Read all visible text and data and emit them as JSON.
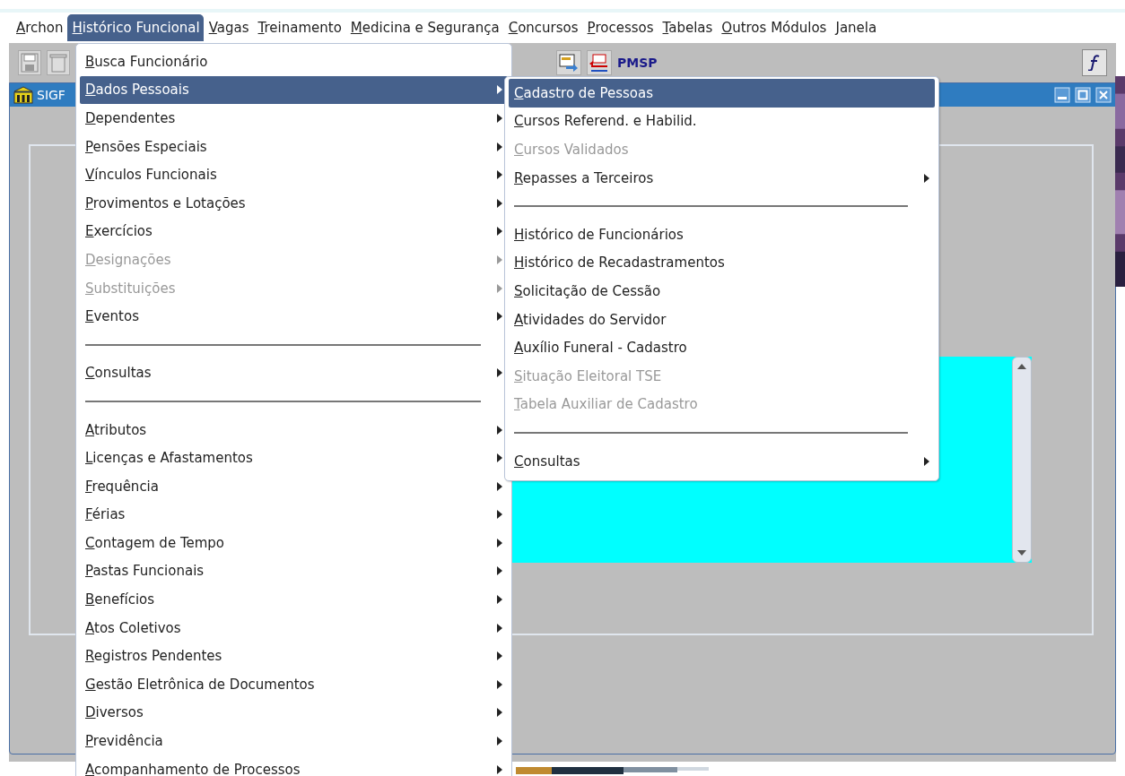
{
  "menubar": [
    {
      "label": "Archon",
      "selected": false
    },
    {
      "label": "Histórico Funcional",
      "selected": true
    },
    {
      "label": "Vagas",
      "selected": false
    },
    {
      "label": "Treinamento",
      "selected": false
    },
    {
      "label": "Medicina e Segurança",
      "selected": false
    },
    {
      "label": "Concursos",
      "selected": false
    },
    {
      "label": "Processos",
      "selected": false
    },
    {
      "label": "Tabelas",
      "selected": false
    },
    {
      "label": "Outros Módulos",
      "selected": false
    },
    {
      "label": "Janela",
      "selected": false
    }
  ],
  "toolbar": {
    "label": "PMSP"
  },
  "window": {
    "title": "SIGF"
  },
  "menu": {
    "items": [
      {
        "kind": "item",
        "label": "Busca Funcionário",
        "selected": false,
        "disabled": false,
        "submenu": false
      },
      {
        "kind": "item",
        "label": "Dados Pessoais",
        "selected": true,
        "disabled": false,
        "submenu": true
      },
      {
        "kind": "item",
        "label": "Dependentes",
        "selected": false,
        "disabled": false,
        "submenu": true
      },
      {
        "kind": "item",
        "label": "Pensões Especiais",
        "selected": false,
        "disabled": false,
        "submenu": true
      },
      {
        "kind": "item",
        "label": "Vínculos Funcionais",
        "selected": false,
        "disabled": false,
        "submenu": true
      },
      {
        "kind": "item",
        "label": "Provimentos e Lotações",
        "selected": false,
        "disabled": false,
        "submenu": true
      },
      {
        "kind": "item",
        "label": "Exercícios",
        "selected": false,
        "disabled": false,
        "submenu": true
      },
      {
        "kind": "item",
        "label": "Designações",
        "selected": false,
        "disabled": true,
        "submenu": true
      },
      {
        "kind": "item",
        "label": "Substituições",
        "selected": false,
        "disabled": true,
        "submenu": true
      },
      {
        "kind": "item",
        "label": "Eventos",
        "selected": false,
        "disabled": false,
        "submenu": true
      },
      {
        "kind": "separator"
      },
      {
        "kind": "item",
        "label": "Consultas",
        "selected": false,
        "disabled": false,
        "submenu": true
      },
      {
        "kind": "separator"
      },
      {
        "kind": "item",
        "label": "Atributos",
        "selected": false,
        "disabled": false,
        "submenu": true
      },
      {
        "kind": "item",
        "label": "Licenças e Afastamentos",
        "selected": false,
        "disabled": false,
        "submenu": true
      },
      {
        "kind": "item",
        "label": "Frequência",
        "selected": false,
        "disabled": false,
        "submenu": true
      },
      {
        "kind": "item",
        "label": "Férias",
        "selected": false,
        "disabled": false,
        "submenu": true
      },
      {
        "kind": "item",
        "label": "Contagem de Tempo",
        "selected": false,
        "disabled": false,
        "submenu": true
      },
      {
        "kind": "item",
        "label": "Pastas Funcionais",
        "selected": false,
        "disabled": false,
        "submenu": true
      },
      {
        "kind": "item",
        "label": "Benefícios",
        "selected": false,
        "disabled": false,
        "submenu": true
      },
      {
        "kind": "item",
        "label": "Atos Coletivos",
        "selected": false,
        "disabled": false,
        "submenu": true
      },
      {
        "kind": "item",
        "label": "Registros Pendentes",
        "selected": false,
        "disabled": false,
        "submenu": true
      },
      {
        "kind": "item",
        "label": "Gestão Eletrônica de Documentos",
        "selected": false,
        "disabled": false,
        "submenu": true
      },
      {
        "kind": "item",
        "label": "Diversos",
        "selected": false,
        "disabled": false,
        "submenu": true
      },
      {
        "kind": "item",
        "label": "Previdência",
        "selected": false,
        "disabled": false,
        "submenu": true
      },
      {
        "kind": "item",
        "label": "Acompanhamento de Processos",
        "selected": false,
        "disabled": false,
        "submenu": true
      }
    ]
  },
  "submenu": {
    "items": [
      {
        "kind": "item",
        "label": "Cadastro de Pessoas",
        "selected": true,
        "disabled": false,
        "submenu": false
      },
      {
        "kind": "item",
        "label": "Cursos Referend. e Habilid.",
        "selected": false,
        "disabled": false,
        "submenu": false
      },
      {
        "kind": "item",
        "label": "Cursos Validados",
        "selected": false,
        "disabled": true,
        "submenu": false
      },
      {
        "kind": "item",
        "label": "Repasses a Terceiros",
        "selected": false,
        "disabled": false,
        "submenu": true
      },
      {
        "kind": "separator"
      },
      {
        "kind": "item",
        "label": "Histórico de Funcionários",
        "selected": false,
        "disabled": false,
        "submenu": false
      },
      {
        "kind": "item",
        "label": "Histórico de Recadastramentos",
        "selected": false,
        "disabled": false,
        "submenu": false
      },
      {
        "kind": "item",
        "label": "Solicitação de Cessão",
        "selected": false,
        "disabled": false,
        "submenu": false
      },
      {
        "kind": "item",
        "label": "Atividades do Servidor",
        "selected": false,
        "disabled": false,
        "submenu": false
      },
      {
        "kind": "item",
        "label": "Auxílio Funeral - Cadastro",
        "selected": false,
        "disabled": false,
        "submenu": false
      },
      {
        "kind": "item",
        "label": "Situação Eleitoral TSE",
        "selected": false,
        "disabled": true,
        "submenu": false
      },
      {
        "kind": "item",
        "label": "Tabela Auxiliar de Cadastro",
        "selected": false,
        "disabled": true,
        "submenu": false
      },
      {
        "kind": "separator"
      },
      {
        "kind": "item",
        "label": "Consultas",
        "selected": false,
        "disabled": false,
        "submenu": true
      }
    ]
  }
}
